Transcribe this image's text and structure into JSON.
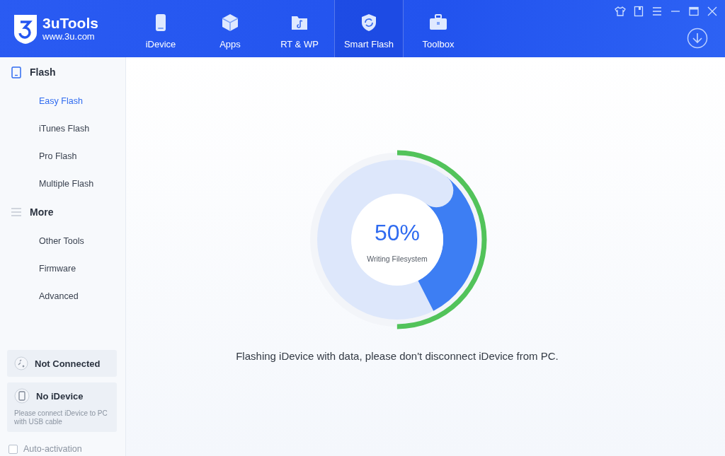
{
  "app": {
    "name": "3uTools",
    "url": "www.3u.com"
  },
  "nav": [
    {
      "label": "iDevice",
      "selected": false
    },
    {
      "label": "Apps",
      "selected": false
    },
    {
      "label": "RT & WP",
      "selected": false
    },
    {
      "label": "Smart Flash",
      "selected": true
    },
    {
      "label": "Toolbox",
      "selected": false
    }
  ],
  "sidebar": {
    "sections": [
      {
        "title": "Flash",
        "kind": "device",
        "items": [
          {
            "label": "Easy Flash",
            "selected": true
          },
          {
            "label": "iTunes Flash",
            "selected": false
          },
          {
            "label": "Pro Flash",
            "selected": false
          },
          {
            "label": "Multiple Flash",
            "selected": false
          }
        ]
      },
      {
        "title": "More",
        "kind": "list",
        "items": [
          {
            "label": "Other Tools",
            "selected": false
          },
          {
            "label": "Firmware",
            "selected": false
          },
          {
            "label": "Advanced",
            "selected": false
          }
        ]
      }
    ],
    "status_cards": [
      {
        "kind": "link",
        "title": "Not Connected"
      },
      {
        "kind": "device",
        "title": "No iDevice",
        "description": "Please connect iDevice to PC with USB cable"
      }
    ],
    "auto_activation": {
      "label": "Auto-activation",
      "checked": false
    }
  },
  "progress": {
    "percent": "50%",
    "stage": "Writing Filesystem",
    "level": 0.5,
    "message": "Flashing iDevice with data, please don't disconnect iDevice from PC."
  }
}
